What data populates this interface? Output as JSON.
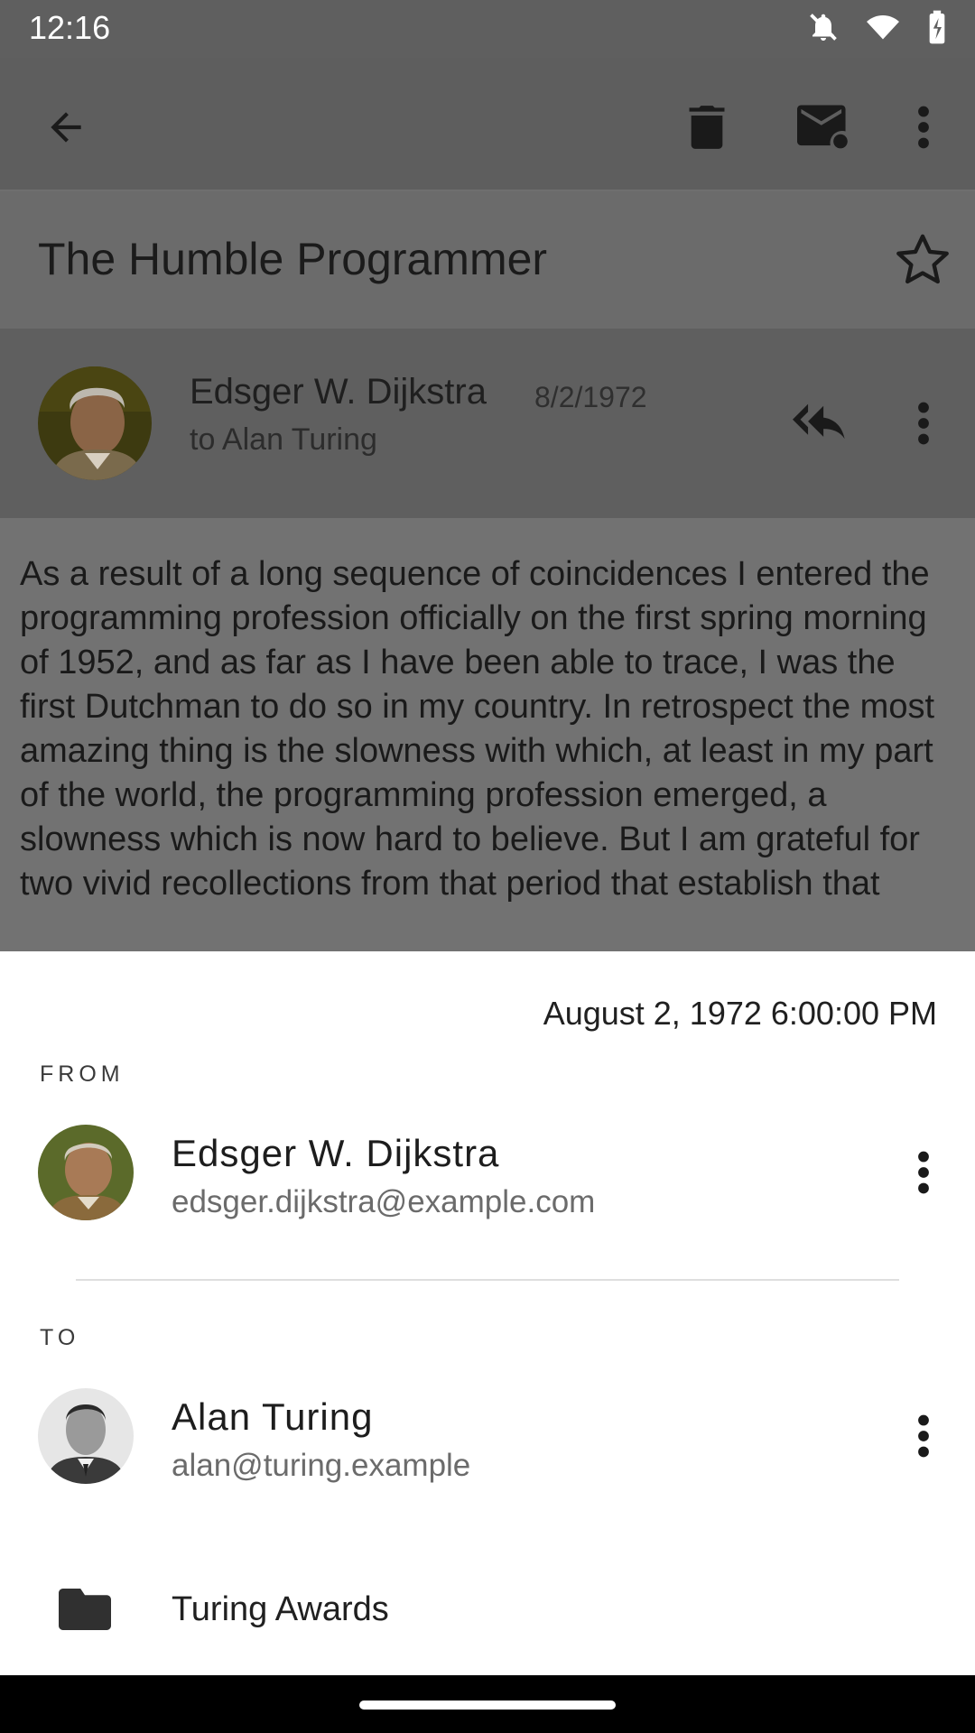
{
  "status": {
    "time": "12:16",
    "icons": [
      "notifications-off-icon",
      "wifi-icon",
      "battery-charging-icon"
    ]
  },
  "app_bar": {
    "icons": [
      "back-arrow-icon",
      "delete-icon",
      "mark-unread-icon",
      "more-vert-icon"
    ]
  },
  "email": {
    "subject": "The Humble Programmer",
    "sender_name": "Edsger W. Dijkstra",
    "date_short": "8/2/1972",
    "to_line": "to Alan Turing",
    "body": "As a result of a long sequence of coincidences I entered the programming profession officially on the first spring morning of 1952, and as far as I have been able to trace, I was the first Dutchman to do so in my country. In retrospect the most amazing thing is the slowness with which, at least in my part of the world, the programming profession emerged, a slowness which is now hard to believe. But I am grateful for two vivid recollections from that period that establish that"
  },
  "details": {
    "date_full": "August 2, 1972 6:00:00 PM",
    "from_label": "FROM",
    "from": {
      "name": "Edsger W. Dijkstra",
      "email": "edsger.dijkstra@example.com"
    },
    "to_label": "TO",
    "to": {
      "name": "Alan Turing",
      "email": "alan@turing.example"
    },
    "folder": "Turing Awards"
  },
  "colors": {
    "scrim_dark": "#5e5e5e",
    "sheet_background": "#ffffff",
    "text_primary": "#1d1d1d",
    "text_secondary": "#6b6b6b"
  }
}
